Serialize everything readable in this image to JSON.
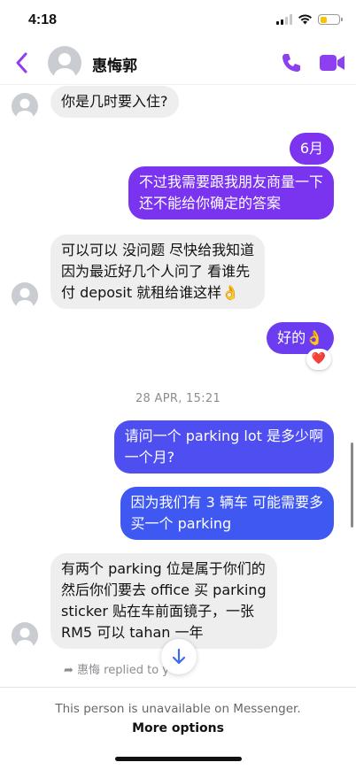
{
  "status_bar": {
    "time": "4:18",
    "battery_color": "#f5c400"
  },
  "header": {
    "contact_name": "惠悔郭",
    "accent": "#8e3ff0"
  },
  "messages": [
    {
      "side": "in",
      "text": "你是几时要入住?"
    },
    {
      "side": "out",
      "text": "6月"
    },
    {
      "side": "out",
      "text": "不过我需要跟我朋友商量一下\n还不能给你确定的答案"
    },
    {
      "side": "in",
      "text": "可以可以 没问题 尽快给我知道\n因为最近好几个人问了 看谁先\n付 deposit 就租给谁这样👌"
    },
    {
      "side": "out",
      "text": "好的👌",
      "reaction": "❤️"
    },
    {
      "side": "out",
      "text": "请问一个 parking lot 是多少啊\n一个月?"
    },
    {
      "side": "out",
      "text": "因为我们有 3 辆车 可能需要多\n买一个 parking"
    },
    {
      "side": "in",
      "text": "有两个 parking 位是属于你们的\n然后你们要去 office 买 parking\nsticker 贴在车前面镜子，一张\nRM5 可以 tahan 一年"
    }
  ],
  "timestamp": "28 APR, 15:21",
  "reply_note": "惠悔 replied to y",
  "footer": {
    "unavailable_text": "This person is unavailable on Messenger.",
    "more_options": "More options"
  },
  "bubble_colors": {
    "incoming": "#eeeeee",
    "outgoing_top": "#8b2ff0",
    "outgoing_bottom": "#3d5af1"
  }
}
